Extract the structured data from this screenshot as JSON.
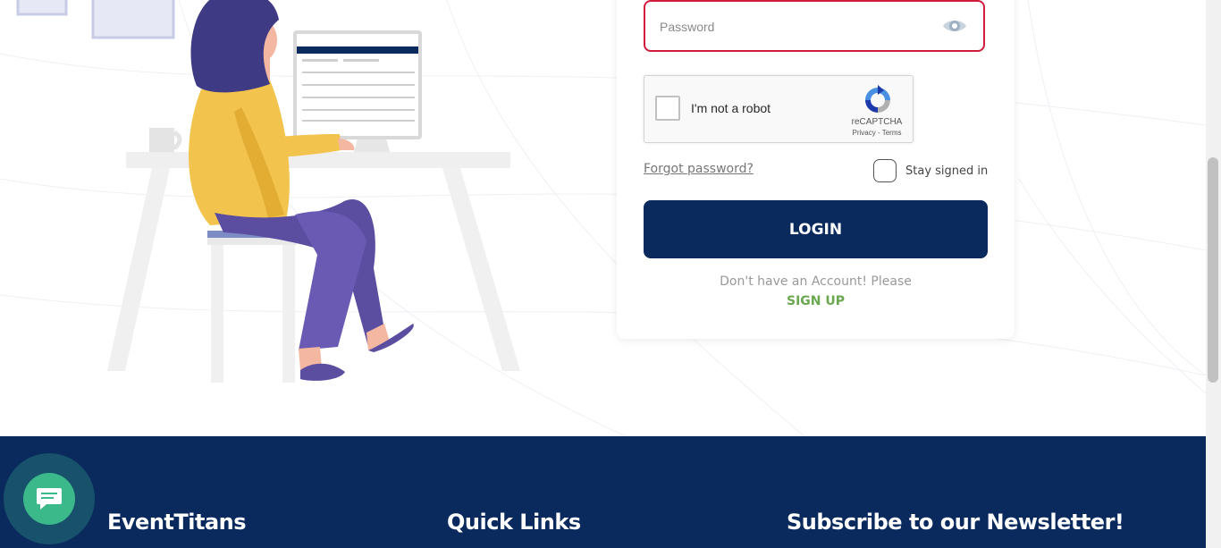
{
  "login": {
    "password_placeholder": "Password",
    "recaptcha": {
      "label": "I'm not a robot",
      "brand": "reCAPTCHA",
      "links": "Privacy - Terms"
    },
    "forgot_password": "Forgot password?",
    "stay_signed_in": "Stay signed in",
    "login_button": "LOGIN",
    "no_account_text": "Don't have an Account! Please",
    "signup_link": "SIGN UP"
  },
  "footer": {
    "brand": "EventTitans",
    "quick_links": "Quick Links",
    "newsletter": "Subscribe to our Newsletter!"
  },
  "icons": [
    "eye-icon",
    "recaptcha-logo-icon",
    "chat-icon"
  ],
  "colors": {
    "primary": "#0a2a5e",
    "error_border": "#d01b3a",
    "signup_green": "#6aa84f",
    "chat_green": "#3bb98a"
  }
}
